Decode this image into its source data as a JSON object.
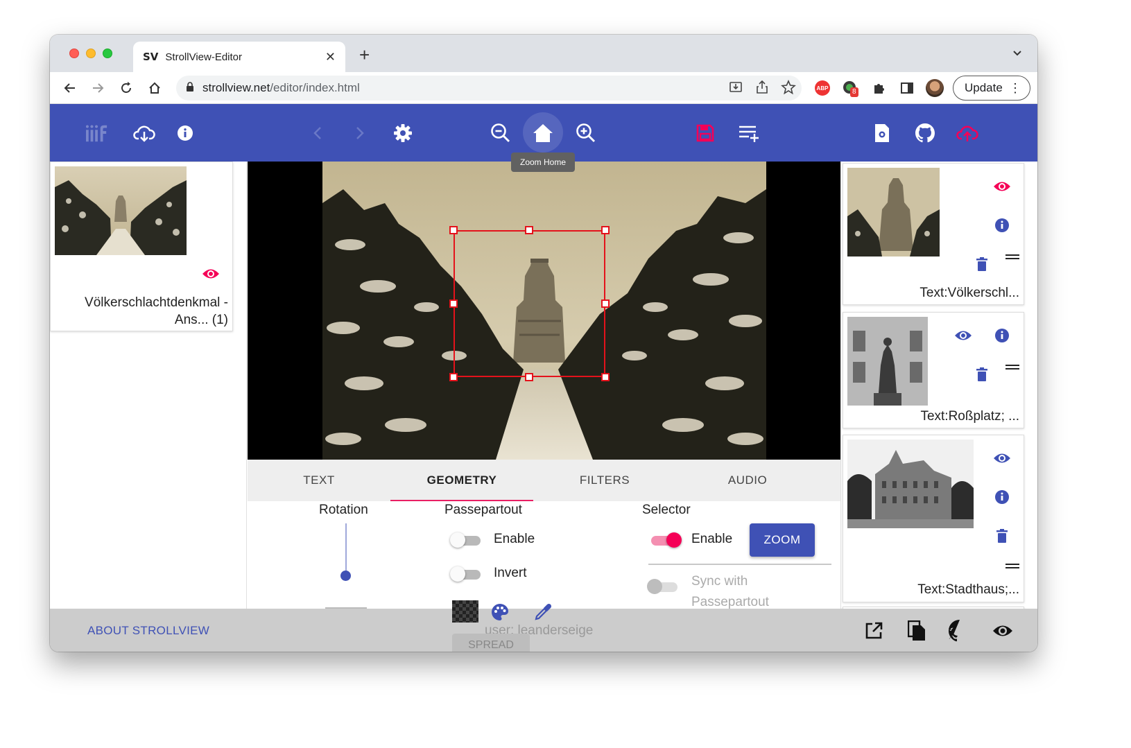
{
  "browser": {
    "tab": {
      "favicon": "SV",
      "title": "StrollView-Editor"
    },
    "url_host": "strollview.net",
    "url_path": "/editor/index.html",
    "extension_badge": "8",
    "update_label": "Update"
  },
  "appbar": {
    "tooltip": "Zoom Home",
    "icons": [
      "iiif-icon",
      "cloud-download-icon",
      "info-icon",
      "chevron-left-icon",
      "chevron-right-icon",
      "settings-icon",
      "zoom-out-icon",
      "home-icon",
      "zoom-in-icon",
      "save-icon",
      "playlist-add-icon",
      "settings-file-icon",
      "github-icon",
      "cloud-upload-icon"
    ],
    "accent": "#3f51b5",
    "highlight": "#f50057"
  },
  "left_panel": {
    "item_title": "Völkerschlachtdenkmal - Ans... (1)"
  },
  "right_panel": {
    "items": [
      {
        "label": "Text:Völkerschl..."
      },
      {
        "label": "Text:Roßplatz; ..."
      },
      {
        "label": "Text:Stadthaus;..."
      }
    ]
  },
  "editor": {
    "tabs": [
      "TEXT",
      "GEOMETRY",
      "FILTERS",
      "AUDIO"
    ],
    "active_tab": "GEOMETRY",
    "rotation_label": "Rotation",
    "passepartout": {
      "title": "Passepartout",
      "enable_label": "Enable",
      "invert_label": "Invert",
      "spread_label": "SPREAD"
    },
    "selector": {
      "title": "Selector",
      "enable_label": "Enable",
      "zoom_label": "ZOOM",
      "sync_label_line1": "Sync with",
      "sync_label_line2": "Passepartout"
    }
  },
  "footer": {
    "about_label": "ABOUT STROLLVIEW",
    "user": "user: leanderseige"
  }
}
